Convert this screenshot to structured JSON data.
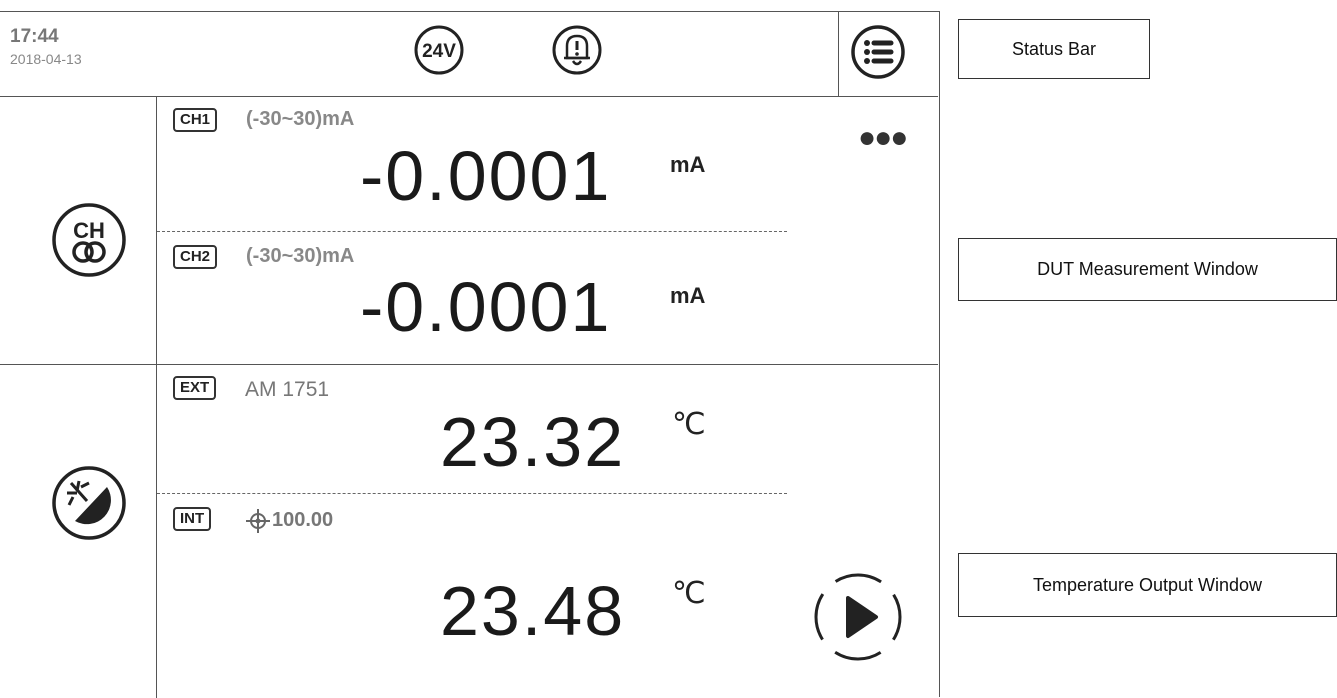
{
  "status_bar": {
    "time": "17:44",
    "date": "2018-04-13",
    "power_label": "24V"
  },
  "channels": [
    {
      "badge": "CH1",
      "range": "(-30~30)mA",
      "value": "-0.0001",
      "unit": "mA"
    },
    {
      "badge": "CH2",
      "range": "(-30~30)mA",
      "value": "-0.0001",
      "unit": "mA"
    }
  ],
  "temperature": {
    "external": {
      "badge": "EXT",
      "sensor": "AM 1751",
      "value": "23.32",
      "unit": "℃"
    },
    "internal": {
      "badge": "INT",
      "setpoint": "100.00",
      "value": "23.48",
      "unit": "℃"
    }
  },
  "icons": {
    "ch_mode": "ch-mode-icon",
    "temp_mode": "temperature-mode-icon",
    "menu": "menu-icon",
    "alarm": "alarm-icon",
    "power": "24v-icon",
    "play": "play-icon",
    "more": "more-icon",
    "target": "target-icon"
  },
  "annotations": {
    "status_bar": "Status Bar",
    "dut_window": "DUT Measurement Window",
    "temp_window": "Temperature Output Window"
  }
}
